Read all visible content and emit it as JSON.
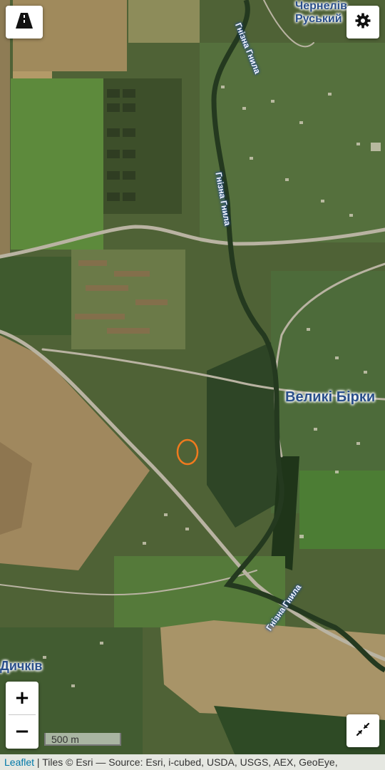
{
  "map": {
    "places": {
      "chernelyiv_ruskyi_line1": "Чернелів",
      "chernelyiv_ruskyi_line2": "Руський",
      "velyki_birky": "Великі Бірки",
      "dychkiv": "Дичків"
    },
    "river_labels": [
      "Гнізна Гнила",
      "Гнізна Гнила",
      "Гнізна Гнила"
    ],
    "highlight_color": "#f07a1e",
    "river_label_color": "#2a4f8a"
  },
  "controls": {
    "roads_toggle_icon": "road-icon",
    "settings_icon": "gear-icon",
    "zoom_in": "+",
    "zoom_out": "−",
    "fit_icon": "collapse-arrows-icon"
  },
  "scale": {
    "label": "500 m"
  },
  "attribution": {
    "leaflet": "Leaflet",
    "tiles": " | Tiles © Esri — Source: Esri, i-cubed, USDA, USGS, AEX, GeoEye,"
  }
}
